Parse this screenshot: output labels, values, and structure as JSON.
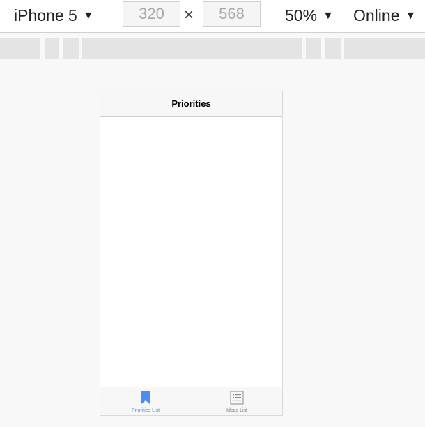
{
  "toolbar": {
    "device": "iPhone 5",
    "width": "320",
    "height": "568",
    "times": "×",
    "zoom": "50%",
    "network": "Online",
    "arrow": "▼"
  },
  "app": {
    "title": "Priorities",
    "tabs": [
      {
        "label": "Priorities List",
        "active": true,
        "icon": "bookmark-icon"
      },
      {
        "label": "Ideas List",
        "active": false,
        "icon": "list-icon"
      }
    ]
  },
  "colors": {
    "accent": "#4a8ef5",
    "inactive": "#8a8a8a"
  }
}
